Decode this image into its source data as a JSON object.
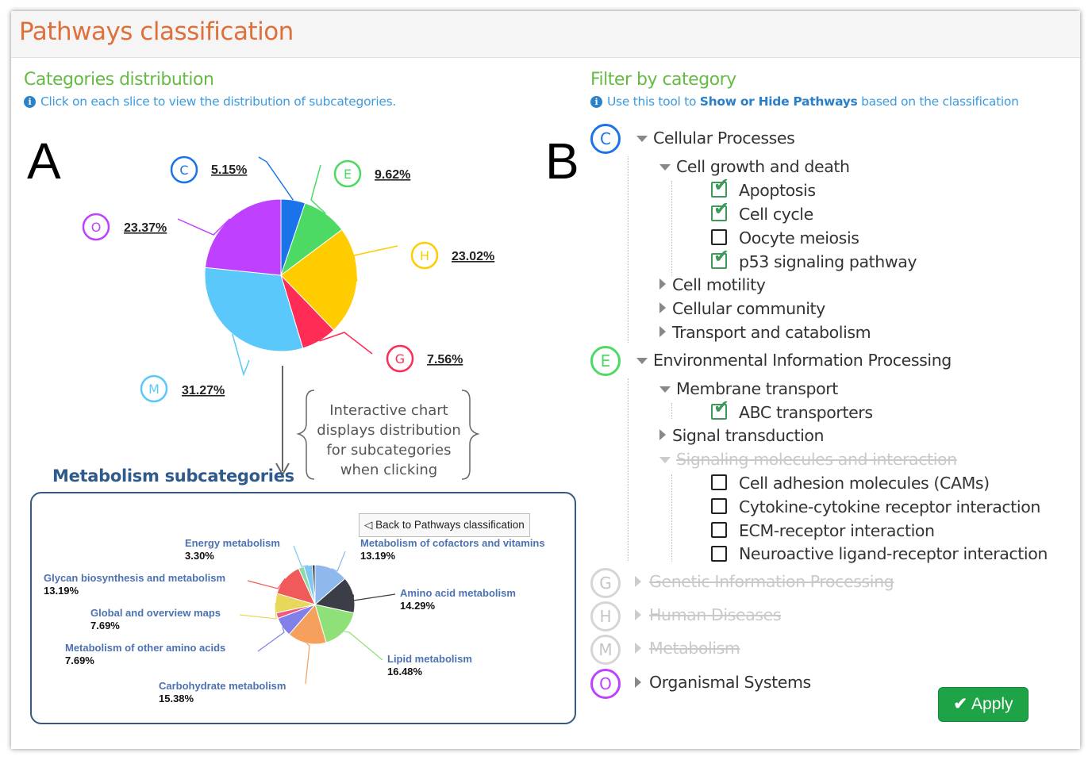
{
  "header": {
    "title": "Pathways classification"
  },
  "left": {
    "title": "Categories distribution",
    "hint": "Click on each slice to view the distribution of subcategories.",
    "panel_letter": "A"
  },
  "right": {
    "title": "Filter by category",
    "hint_pre": "Use this tool to ",
    "hint_bold": "Show or Hide Pathways",
    "hint_post": " based on the classification",
    "panel_letter": "B"
  },
  "chart_data": [
    {
      "type": "pie",
      "title": "",
      "slices": [
        {
          "letter": "C",
          "value": 5.15,
          "label": "5.15%",
          "color": "#1a73e8"
        },
        {
          "letter": "E",
          "value": 9.62,
          "label": "9.62%",
          "color": "#4cd964"
        },
        {
          "letter": "H",
          "value": 23.02,
          "label": "23.02%",
          "color": "#ffcc00"
        },
        {
          "letter": "G",
          "value": 7.56,
          "label": "7.56%",
          "color": "#ff2d55"
        },
        {
          "letter": "M",
          "value": 31.27,
          "label": "31.27%",
          "color": "#5ac8fa"
        },
        {
          "letter": "O",
          "value": 23.37,
          "label": "23.37%",
          "color": "#bf40ff"
        }
      ]
    },
    {
      "type": "pie",
      "title": "Metabolism subcategories",
      "slices": [
        {
          "name": "Metabolism of cofactors and vitamins",
          "value": 13.19,
          "label": "13.19%",
          "color": "#8fb9ec"
        },
        {
          "name": "Amino acid metabolism",
          "value": 14.29,
          "label": "14.29%",
          "color": "#3b3d47"
        },
        {
          "name": "Lipid metabolism",
          "value": 16.48,
          "label": "16.48%",
          "color": "#90e07a"
        },
        {
          "name": "Carbohydrate metabolism",
          "value": 15.38,
          "label": "15.38%",
          "color": "#f5a05c"
        },
        {
          "name": "Metabolism of other amino acids",
          "value": 7.69,
          "label": "7.69%",
          "color": "#8080e8"
        },
        {
          "name": "",
          "value": 2.2,
          "label": "",
          "color": "#f05a7e"
        },
        {
          "name": "Global and overview maps",
          "value": 7.69,
          "label": "7.69%",
          "color": "#e8d85a"
        },
        {
          "name": "Glycan biosynthesis and metabolism",
          "value": 13.19,
          "label": "13.19%",
          "color": "#f05a5a"
        },
        {
          "name": "",
          "value": 2.2,
          "label": "",
          "color": "#8fd9a8"
        },
        {
          "name": "Energy metabolism",
          "value": 3.3,
          "label": "3.30%",
          "color": "#7fc7f0"
        },
        {
          "name": "",
          "value": 1.1,
          "label": "",
          "color": "#3b3d47"
        }
      ]
    }
  ],
  "callout": {
    "lines": [
      "Interactive chart",
      "displays distribution",
      "for subcategories",
      "when clicking"
    ]
  },
  "metabolism": {
    "title": "Metabolism subcategories",
    "back_button": "◁ Back to Pathways classification"
  },
  "tree": {
    "cellular": {
      "letter": "C",
      "label": "Cellular Processes",
      "color": "#1a73e8"
    },
    "cell_growth": "Cell growth and death",
    "apoptosis": "Apoptosis",
    "cell_cycle": "Cell cycle",
    "oocyte": "Oocyte meiosis",
    "p53": "p53 signaling pathway",
    "cell_motility": "Cell motility",
    "cellular_community": "Cellular community",
    "transport": "Transport and catabolism",
    "environmental": {
      "letter": "E",
      "label": "Environmental Information Processing",
      "color": "#4cd964"
    },
    "membrane": "Membrane transport",
    "abc": "ABC transporters",
    "signal": "Signal transduction",
    "signaling_mol": "Signaling molecules and interaction",
    "cams": "Cell adhesion molecules (CAMs)",
    "cytokine": "Cytokine-cytokine receptor interaction",
    "ecm": "ECM-receptor interaction",
    "neuro": "Neuroactive ligand-receptor interaction",
    "genetic": {
      "letter": "G",
      "label": "Genetic Information Processing"
    },
    "human": {
      "letter": "H",
      "label": "Human Diseases"
    },
    "metabolism": {
      "letter": "M",
      "label": "Metabolism"
    },
    "organismal": {
      "letter": "O",
      "label": "Organismal Systems",
      "color": "#bf40ff"
    }
  },
  "apply_button": "Apply"
}
